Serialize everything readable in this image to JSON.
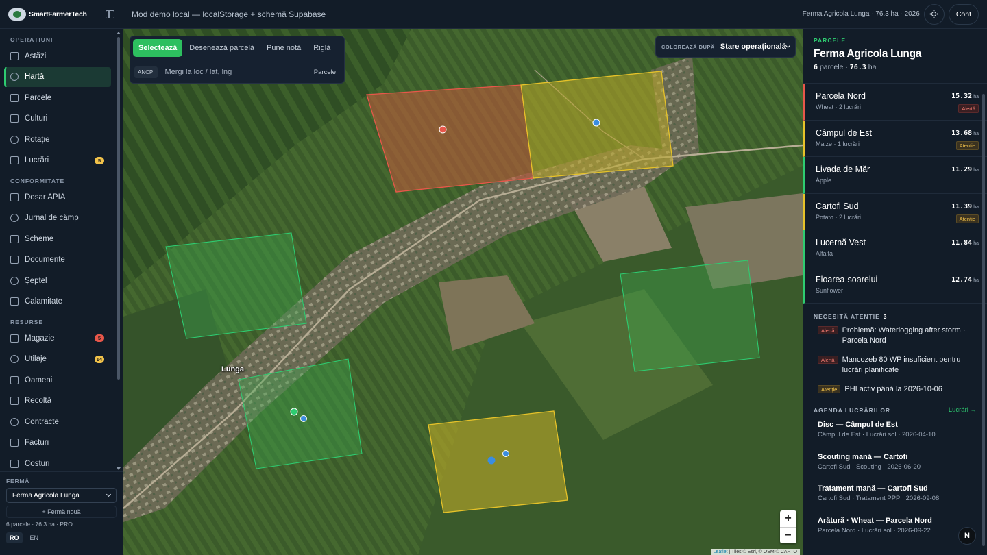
{
  "app": {
    "logo_text": "SmartFarmerTech",
    "mode_text": "Mod demo local — localStorage + schemă Supabase",
    "farm_summary": "Ferma Agricola Lunga · 76.3 ha · 2026",
    "account_label": "Cont",
    "user_initial": "N"
  },
  "sidebar": {
    "sections": [
      {
        "title": "OPERAȚIUNI",
        "items": [
          {
            "label": "Astăzi",
            "icon": "sun-icon"
          },
          {
            "label": "Hartă",
            "icon": "map-icon",
            "active": true
          },
          {
            "label": "Parcele",
            "icon": "layers-icon"
          },
          {
            "label": "Culturi",
            "icon": "sprout-icon"
          },
          {
            "label": "Rotație",
            "icon": "rotate-icon"
          },
          {
            "label": "Lucrări",
            "icon": "clipboard-icon",
            "badge": "5",
            "badge_color": "#f1c24a"
          }
        ]
      },
      {
        "title": "CONFORMITATE",
        "items": [
          {
            "label": "Dosar APIA",
            "icon": "file-icon"
          },
          {
            "label": "Jurnal de câmp",
            "icon": "book-icon"
          },
          {
            "label": "Scheme",
            "icon": "list-icon"
          },
          {
            "label": "Documente",
            "icon": "document-icon"
          },
          {
            "label": "Șeptel",
            "icon": "cow-icon"
          },
          {
            "label": "Calamitate",
            "icon": "warning-icon"
          }
        ]
      },
      {
        "title": "RESURSE",
        "items": [
          {
            "label": "Magazie",
            "icon": "warehouse-icon",
            "badge": "5",
            "badge_color": "#e8574a"
          },
          {
            "label": "Utilaje",
            "icon": "tractor-icon",
            "badge": "14",
            "badge_color": "#f1c24a"
          },
          {
            "label": "Oameni",
            "icon": "users-icon"
          },
          {
            "label": "Recoltă",
            "icon": "wheat-icon"
          },
          {
            "label": "Contracte",
            "icon": "contract-icon"
          },
          {
            "label": "Facturi",
            "icon": "invoice-icon"
          },
          {
            "label": "Costuri",
            "icon": "coins-icon"
          }
        ]
      }
    ],
    "footer": {
      "farm_label": "FERMĂ",
      "farm_selected": "Ferma Agricola Lunga",
      "new_farm": "+ Fermă nouă",
      "stats": "6 parcele · 76.3 ha · PRO",
      "languages": [
        "RO",
        "EN"
      ],
      "active_language": "RO"
    }
  },
  "map": {
    "tools": [
      "Selectează",
      "Desenează parcelă",
      "Pune notă",
      "Riglă"
    ],
    "active_tool": "Selectează",
    "ancpi_label": "ANCPI",
    "goto_placeholder": "Mergi la loc / lat, lng",
    "parcels_button": "Parcele",
    "color_by_label": "COLOREAZĂ DUPĂ",
    "color_by_value": "Stare operațională",
    "place_label": "Lunga",
    "zoom_in": "+",
    "zoom_out": "−",
    "attribution_leaflet": "Leaflet",
    "attribution_rest": " | Tiles © Esri, © OSM © CARTO",
    "status_colors": {
      "alert": "#e8574a",
      "attention": "#e6c229",
      "ok": "#2ecc71",
      "marker_blue": "#3b8de0"
    }
  },
  "panel": {
    "kicker": "PARCELE",
    "farm_name": "Ferma Agricola Lunga",
    "parcel_count": "6",
    "parcel_word": "parcele ·",
    "total_area": "76.3",
    "area_unit": "ha",
    "parcels": [
      {
        "name": "Parcela Nord",
        "sub": "Wheat · 2 lucrări",
        "area": "15.32",
        "unit": "ha",
        "tag": "Alertă",
        "status": "alert"
      },
      {
        "name": "Câmpul de Est",
        "sub": "Maize · 1 lucrări",
        "area": "13.68",
        "unit": "ha",
        "tag": "Atenție",
        "status": "attention"
      },
      {
        "name": "Livada de Măr",
        "sub": "Apple",
        "area": "11.29",
        "unit": "ha",
        "tag": "",
        "status": "ok"
      },
      {
        "name": "Cartofi Sud",
        "sub": "Potato · 2 lucrări",
        "area": "11.39",
        "unit": "ha",
        "tag": "Atenție",
        "status": "attention"
      },
      {
        "name": "Lucernă Vest",
        "sub": "Alfalfa",
        "area": "11.84",
        "unit": "ha",
        "tag": "",
        "status": "ok"
      },
      {
        "name": "Floarea-soarelui",
        "sub": "Sunflower",
        "area": "12.74",
        "unit": "ha",
        "tag": "",
        "status": "ok"
      }
    ],
    "attention_title": "NECESITĂ ATENȚIE",
    "attention_count": "3",
    "attention": [
      {
        "tag": "Alertă",
        "status": "alert",
        "text": "Problemă: Waterlogging after storm · Parcela Nord"
      },
      {
        "tag": "Alertă",
        "status": "alert",
        "text": "Mancozeb 80 WP insuficient pentru lucrări planificate"
      },
      {
        "tag": "Atenție",
        "status": "attention",
        "text": "PHI activ până la 2026-10-06"
      }
    ],
    "agenda_title": "AGENDA LUCRĂRILOR",
    "agenda_link": "Lucrări →",
    "agenda": [
      {
        "title": "Disc — Câmpul de Est",
        "sub": "Câmpul de Est · Lucrări sol · 2026-04-10"
      },
      {
        "title": "Scouting mană — Cartofi",
        "sub": "Cartofi Sud · Scouting · 2026-06-20"
      },
      {
        "title": "Tratament mană — Cartofi Sud",
        "sub": "Cartofi Sud · Tratament PPP · 2026-09-08"
      },
      {
        "title": "Arătură · Wheat — Parcela Nord",
        "sub": "Parcela Nord · Lucrări sol · 2026-09-22"
      }
    ]
  }
}
